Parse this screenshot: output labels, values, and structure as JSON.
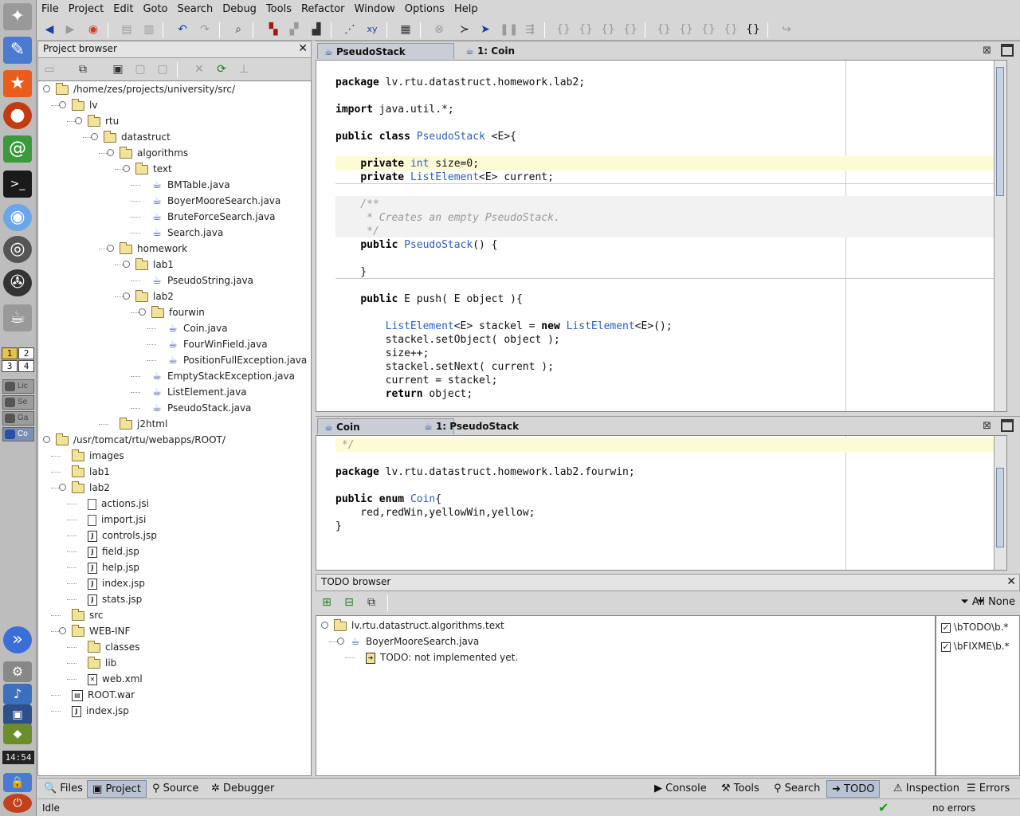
{
  "menu": [
    "File",
    "Project",
    "Edit",
    "Goto",
    "Search",
    "Debug",
    "Tools",
    "Refactor",
    "Window",
    "Options",
    "Help"
  ],
  "dock": {
    "workspaces": [
      "1",
      "2",
      "3",
      "4"
    ],
    "tasks": [
      "Lic",
      "Se",
      "Ga",
      "Co"
    ],
    "clock": "14:54"
  },
  "project_browser": {
    "title": "Project browser",
    "tree": [
      {
        "label": "/home/zes/projects/university/src/",
        "depth": 0,
        "icon": "folder"
      },
      {
        "label": "lv",
        "depth": 1,
        "icon": "folder"
      },
      {
        "label": "rtu",
        "depth": 2,
        "icon": "folder"
      },
      {
        "label": "datastruct",
        "depth": 3,
        "icon": "folder"
      },
      {
        "label": "algorithms",
        "depth": 4,
        "icon": "folder"
      },
      {
        "label": "text",
        "depth": 5,
        "icon": "folder"
      },
      {
        "label": "BMTable.java",
        "depth": 6,
        "icon": "java"
      },
      {
        "label": "BoyerMooreSearch.java",
        "depth": 6,
        "icon": "java"
      },
      {
        "label": "BruteForceSearch.java",
        "depth": 6,
        "icon": "java"
      },
      {
        "label": "Search.java",
        "depth": 6,
        "icon": "java"
      },
      {
        "label": "homework",
        "depth": 4,
        "icon": "folder"
      },
      {
        "label": "lab1",
        "depth": 5,
        "icon": "folder"
      },
      {
        "label": "PseudoString.java",
        "depth": 6,
        "icon": "java"
      },
      {
        "label": "lab2",
        "depth": 5,
        "icon": "folder"
      },
      {
        "label": "fourwin",
        "depth": 6,
        "icon": "folder"
      },
      {
        "label": "Coin.java",
        "depth": 7,
        "icon": "java"
      },
      {
        "label": "FourWinField.java",
        "depth": 7,
        "icon": "java"
      },
      {
        "label": "PositionFullException.java",
        "depth": 7,
        "icon": "java"
      },
      {
        "label": "EmptyStackException.java",
        "depth": 6,
        "icon": "java"
      },
      {
        "label": "ListElement.java",
        "depth": 6,
        "icon": "java"
      },
      {
        "label": "PseudoStack.java",
        "depth": 6,
        "icon": "java"
      },
      {
        "label": "j2html",
        "depth": 4,
        "icon": "folder"
      },
      {
        "label": "/usr/tomcat/rtu/webapps/ROOT/",
        "depth": 0,
        "icon": "folder"
      },
      {
        "label": "images",
        "depth": 1,
        "icon": "folder"
      },
      {
        "label": "lab1",
        "depth": 1,
        "icon": "folder"
      },
      {
        "label": "lab2",
        "depth": 1,
        "icon": "folder"
      },
      {
        "label": "actions.jsi",
        "depth": 2,
        "icon": "doc"
      },
      {
        "label": "import.jsi",
        "depth": 2,
        "icon": "doc"
      },
      {
        "label": "controls.jsp",
        "depth": 2,
        "icon": "jsp"
      },
      {
        "label": "field.jsp",
        "depth": 2,
        "icon": "jsp"
      },
      {
        "label": "help.jsp",
        "depth": 2,
        "icon": "jsp"
      },
      {
        "label": "index.jsp",
        "depth": 2,
        "icon": "jsp"
      },
      {
        "label": "stats.jsp",
        "depth": 2,
        "icon": "jsp"
      },
      {
        "label": "src",
        "depth": 1,
        "icon": "folder"
      },
      {
        "label": "WEB-INF",
        "depth": 1,
        "icon": "folder"
      },
      {
        "label": "classes",
        "depth": 2,
        "icon": "folder"
      },
      {
        "label": "lib",
        "depth": 2,
        "icon": "folder"
      },
      {
        "label": "web.xml",
        "depth": 2,
        "icon": "xml"
      },
      {
        "label": "ROOT.war",
        "depth": 1,
        "icon": "war"
      },
      {
        "label": "index.jsp",
        "depth": 1,
        "icon": "jsp"
      }
    ]
  },
  "editor1": {
    "tabs": [
      {
        "label": "PseudoStack",
        "active": true
      },
      {
        "label": "1: Coin",
        "active": false
      }
    ],
    "lines": [
      "",
      "package lv.rtu.datastruct.homework.lab2;",
      "",
      "import java.util.*;",
      "",
      "public class PseudoStack <E>{",
      "",
      "    private int size=0;",
      "    private ListElement<E> current;",
      "",
      "    /**",
      "     * Creates an empty PseudoStack.",
      "     */",
      "    public PseudoStack() {",
      "",
      "    }",
      "",
      "    public E push( E object ){",
      "",
      "        ListElement<E> stackel = new ListElement<E>();",
      "        stackel.setObject( object );",
      "        size++;",
      "        stackel.setNext( current );",
      "        current = stackel;",
      "        return object;"
    ]
  },
  "editor2": {
    "tabs": [
      {
        "label": "Coin",
        "active": true
      },
      {
        "label": "1: PseudoStack",
        "active": false
      }
    ],
    "lines": [
      " */",
      "",
      "package lv.rtu.datastruct.homework.lab2.fourwin;",
      "",
      "public enum Coin{",
      "    red,redWin,yellowWin,yellow;",
      "}"
    ]
  },
  "todo": {
    "title": "TODO browser",
    "filter_all": "All",
    "filter_none": "None",
    "tree": [
      {
        "label": "lv.rtu.datastruct.algorithms.text",
        "depth": 0,
        "icon": "folder"
      },
      {
        "label": "BoyerMooreSearch.java",
        "depth": 1,
        "icon": "java"
      },
      {
        "label": "TODO: not implemented yet.",
        "depth": 2,
        "icon": "todo"
      }
    ],
    "patterns": [
      {
        "label": "\\bTODO\\b.*",
        "checked": true
      },
      {
        "label": "\\bFIXME\\b.*",
        "checked": true
      }
    ]
  },
  "bottom_left": [
    {
      "label": "Files",
      "icon": "files-icon"
    },
    {
      "label": "Project",
      "icon": "project-icon",
      "active": true
    },
    {
      "label": "Source",
      "icon": "source-icon"
    },
    {
      "label": "Debugger",
      "icon": "debugger-icon"
    }
  ],
  "bottom_right": [
    {
      "label": "Console",
      "icon": "console-icon"
    },
    {
      "label": "Tools",
      "icon": "tools-icon"
    },
    {
      "label": "Search",
      "icon": "search-icon"
    },
    {
      "label": "TODO",
      "icon": "todo-icon",
      "active": true
    },
    {
      "label": "Inspection",
      "icon": "inspection-icon"
    },
    {
      "label": "Errors",
      "icon": "errors-icon"
    }
  ],
  "status": {
    "left": "Idle",
    "right": "no errors"
  }
}
